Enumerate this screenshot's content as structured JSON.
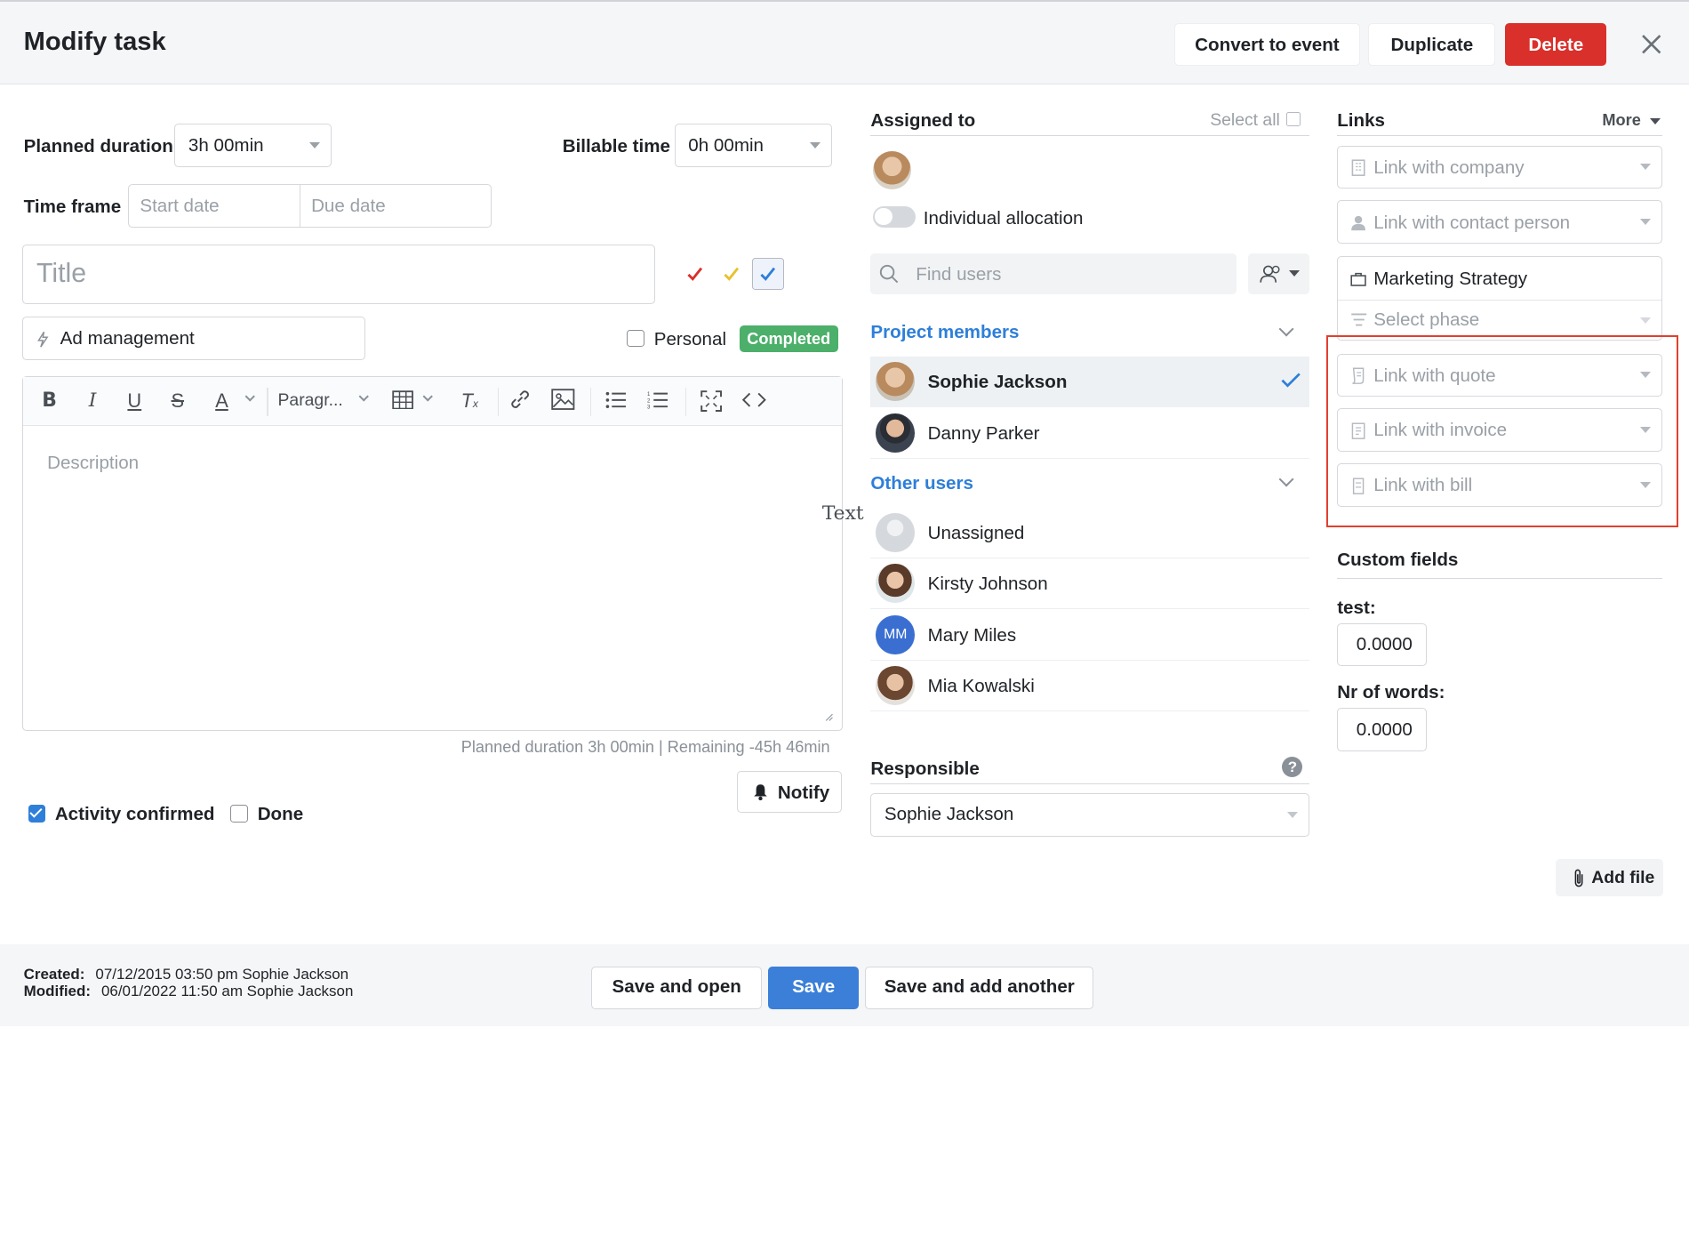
{
  "header": {
    "title": "Modify task",
    "convert_label": "Convert to event",
    "duplicate_label": "Duplicate",
    "delete_label": "Delete"
  },
  "form": {
    "planned_duration_label": "Planned duration",
    "planned_duration_value": "3h 00min",
    "billable_time_label": "Billable time",
    "billable_time_value": "0h 00min",
    "time_frame_label": "Time frame",
    "start_date_placeholder": "Start date",
    "due_date_placeholder": "Due date",
    "title_placeholder": "Title",
    "activity_type": "Ad management",
    "personal_label": "Personal",
    "status_badge": "Completed",
    "description_placeholder": "Description",
    "floating_text": "Text",
    "duration_summary": "Planned duration 3h 00min | Remaining -45h 46min",
    "notify_label": "Notify",
    "activity_confirmed_label": "Activity confirmed",
    "activity_confirmed": true,
    "done_label": "Done",
    "done": false,
    "personal": false
  },
  "toolbar": {
    "paragraph_label": "Paragr..."
  },
  "colors": {
    "accent": "#2e7fd9",
    "danger": "#d9302c",
    "success": "#4caf6a",
    "highlight": "#e0402e"
  },
  "assigned": {
    "title": "Assigned to",
    "select_all": "Select all",
    "individual_allocation": "Individual allocation",
    "find_placeholder": "Find users",
    "project_members_title": "Project members",
    "other_users_title": "Other users",
    "project_members": [
      {
        "name": "Sophie Jackson",
        "selected": true
      },
      {
        "name": "Danny Parker",
        "selected": false
      }
    ],
    "other_users": [
      {
        "name": "Unassigned",
        "initials": ""
      },
      {
        "name": "Kirsty Johnson",
        "initials": ""
      },
      {
        "name": "Mary Miles",
        "initials": "MM"
      },
      {
        "name": "Mia Kowalski",
        "initials": ""
      }
    ]
  },
  "responsible": {
    "title": "Responsible",
    "value": "Sophie Jackson"
  },
  "links": {
    "title": "Links",
    "more_label": "More",
    "company": "Link with company",
    "contact": "Link with contact person",
    "project": "Marketing Strategy",
    "phase": "Select phase",
    "quote": "Link with quote",
    "invoice": "Link with invoice",
    "bill": "Link with bill"
  },
  "custom_fields": {
    "title": "Custom fields",
    "fields": [
      {
        "label": "test:",
        "value": "0.0000"
      },
      {
        "label": "Nr of words:",
        "value": "0.0000"
      }
    ]
  },
  "add_file_label": "Add file",
  "footer": {
    "created_label": "Created:",
    "created_value": "07/12/2015 03:50 pm Sophie Jackson",
    "modified_label": "Modified:",
    "modified_value": "06/01/2022 11:50 am Sophie Jackson",
    "save_open_label": "Save and open",
    "save_label": "Save",
    "save_add_label": "Save and add another"
  }
}
